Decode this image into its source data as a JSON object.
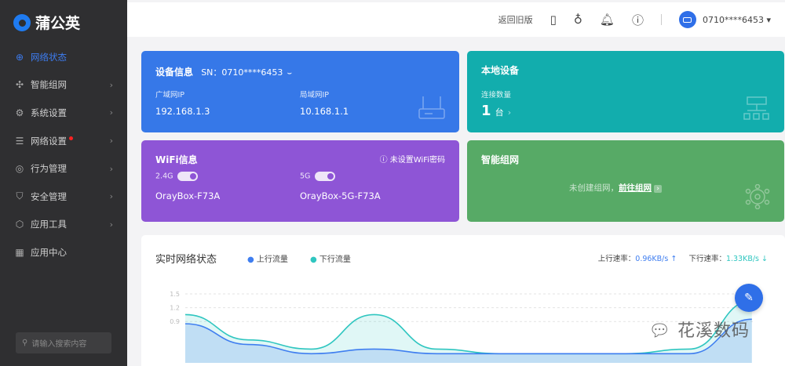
{
  "app": {
    "name": "蒲公英"
  },
  "sidebar": {
    "items": [
      {
        "label": "网络状态",
        "icon": "globe-icon",
        "glyph": "⊕",
        "active": true,
        "chevron": false
      },
      {
        "label": "智能组网",
        "icon": "mesh-icon",
        "glyph": "✣",
        "chevron": true
      },
      {
        "label": "系统设置",
        "icon": "gear-icon",
        "glyph": "⚙",
        "chevron": true
      },
      {
        "label": "网络设置",
        "icon": "sliders-icon",
        "glyph": "☰",
        "chevron": true,
        "badge": true
      },
      {
        "label": "行为管理",
        "icon": "link-icon",
        "glyph": "◎",
        "chevron": true
      },
      {
        "label": "安全管理",
        "icon": "shield-icon",
        "glyph": "⛉",
        "chevron": true
      },
      {
        "label": "应用工具",
        "icon": "toolbox-icon",
        "glyph": "⬡",
        "chevron": true
      },
      {
        "label": "应用中心",
        "icon": "grid-icon",
        "glyph": "▦",
        "chevron": false
      }
    ],
    "search_placeholder": "请输入搜索内容"
  },
  "topbar": {
    "back_old": "返回旧版",
    "user": "0710****6453"
  },
  "device": {
    "title": "设备信息",
    "sn": "SN：0710****6453",
    "wan_label": "广域网IP",
    "wan": "192.168.1.3",
    "lan_label": "局域网IP",
    "lan": "10.168.1.1"
  },
  "local": {
    "title": "本地设备",
    "count_label": "连接数量",
    "count": "1",
    "unit": "台"
  },
  "wifi": {
    "title": "WiFi信息",
    "warning": "未设置WiFi密码",
    "band1": "2.4G",
    "ssid1": "OrayBox-F73A",
    "band2": "5G",
    "ssid2": "OrayBox-5G-F73A"
  },
  "mesh": {
    "title": "智能组网",
    "empty": "未创建组网，",
    "link": "前往组网"
  },
  "network": {
    "title": "实时网络状态",
    "legend_up": "上行流量",
    "legend_down": "下行流量",
    "up_label": "上行速率：",
    "up_value": "0.96KB/s",
    "down_label": "下行速率：",
    "down_value": "1.33KB/s"
  },
  "watermark": "花溪数码",
  "colors": {
    "blue": "#3678e8",
    "purple": "#8e55d6",
    "teal": "#12adad",
    "green": "#57aa66",
    "up": "#3f7ef0",
    "down": "#2fc6c0"
  },
  "chart_data": {
    "type": "area",
    "yticks": [
      "1.5",
      "1.2",
      "0.9"
    ],
    "ylim": [
      0,
      1.5
    ],
    "series": [
      {
        "name": "下行流量",
        "values": [
          1.05,
          0.5,
          0.3,
          1.05,
          0.3,
          0.2,
          0.2,
          0.2,
          0.3,
          1.35
        ]
      },
      {
        "name": "上行流量",
        "values": [
          0.85,
          0.4,
          0.2,
          0.3,
          0.2,
          0.2,
          0.2,
          0.2,
          0.2,
          0.95
        ]
      }
    ]
  }
}
